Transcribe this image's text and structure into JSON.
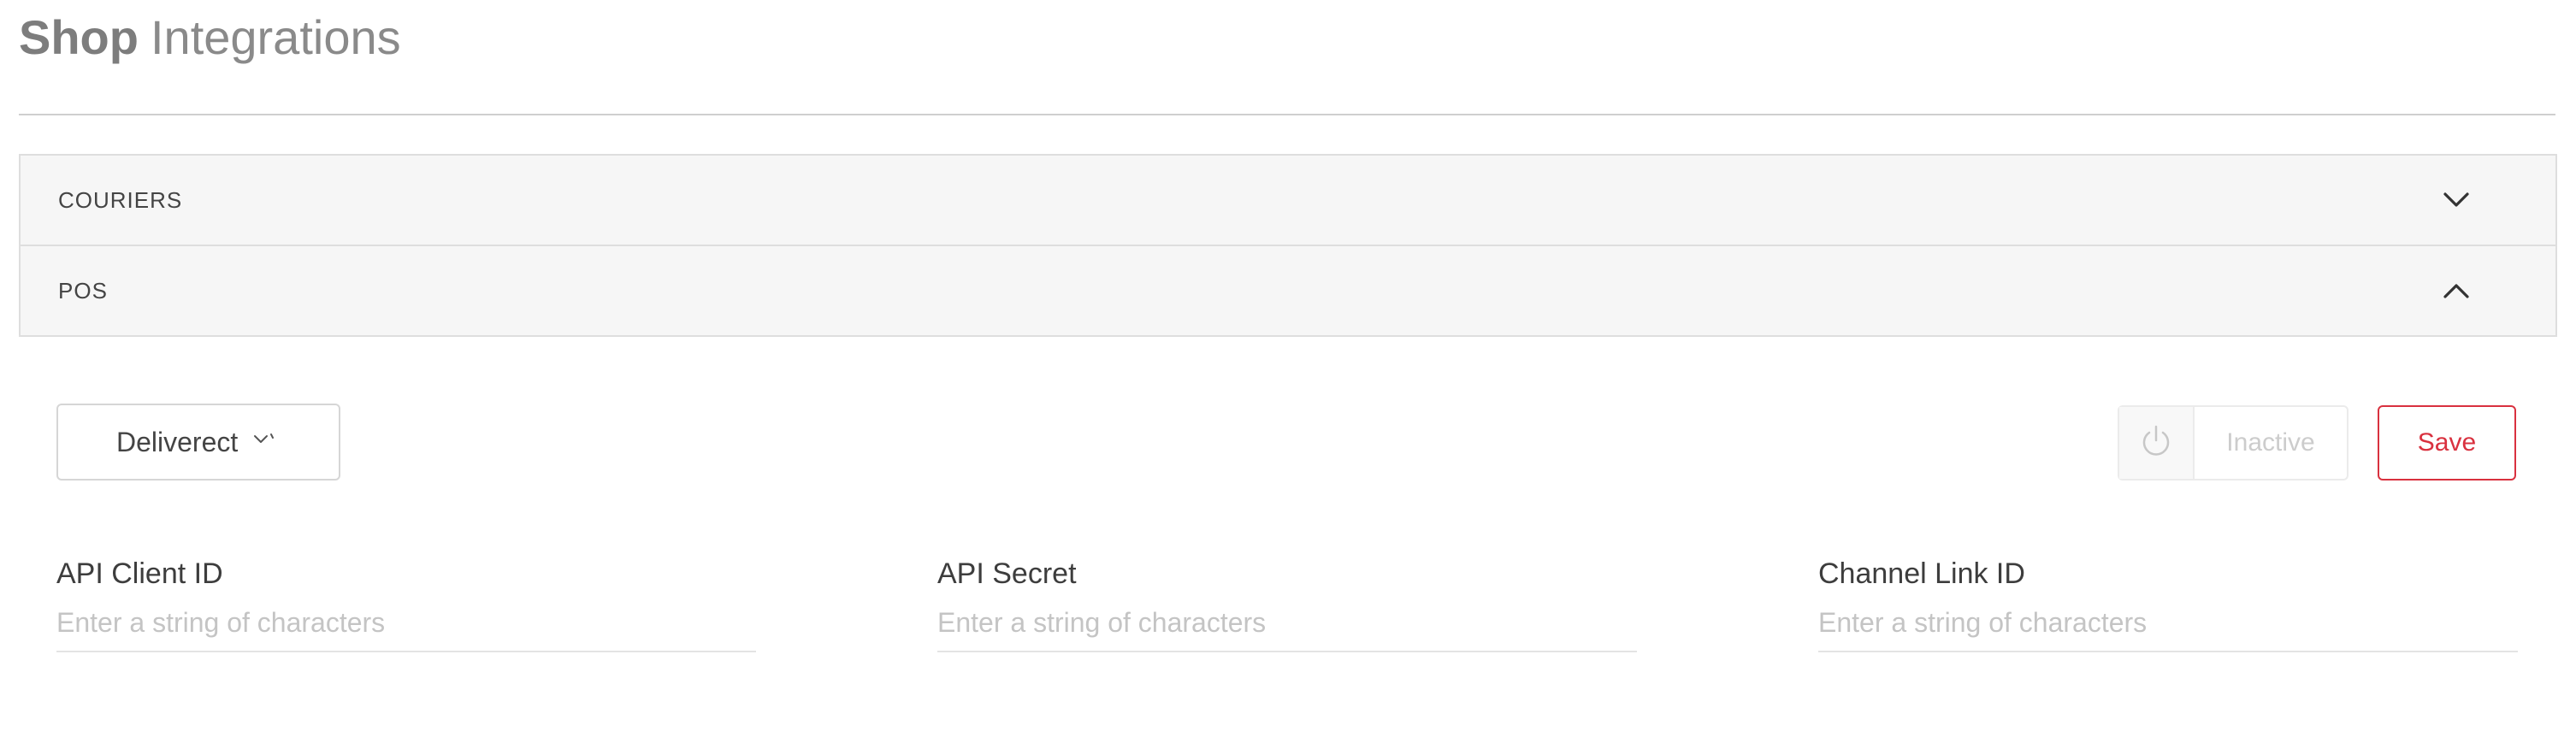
{
  "header": {
    "title_bold": "Shop",
    "title_light": "Integrations"
  },
  "accordion": {
    "sections": [
      {
        "label": "COURIERS",
        "state": "collapsed",
        "icon": "chevron-down-icon"
      },
      {
        "label": "POS",
        "state": "expanded",
        "icon": "chevron-up-icon"
      }
    ]
  },
  "pos": {
    "provider_select": {
      "value": "Deliverect",
      "icon": "caret-down-icon"
    },
    "status_toggle": {
      "label": "Inactive",
      "icon": "power-icon"
    },
    "save_label": "Save",
    "fields": [
      {
        "label": "API Client ID",
        "value": "",
        "placeholder": "Enter a string of characters"
      },
      {
        "label": "API Secret",
        "value": "",
        "placeholder": "Enter a string of characters"
      },
      {
        "label": "Channel Link ID",
        "value": "",
        "placeholder": "Enter a string of characters"
      }
    ]
  },
  "colors": {
    "accent": "#d9313f",
    "panel_background": "#f6f6f6",
    "border": "#dedede",
    "muted_text": "#c4c4c4"
  }
}
